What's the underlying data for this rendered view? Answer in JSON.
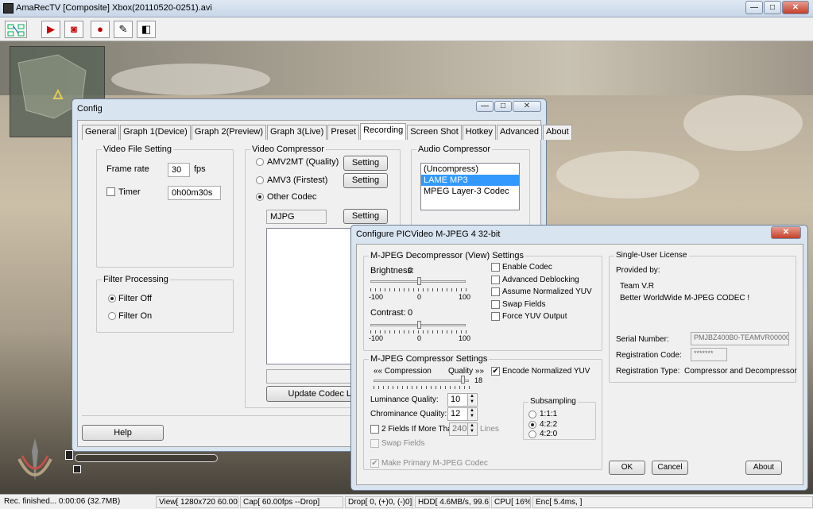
{
  "main": {
    "title": "AmaRecTV  [Composite]  Xbox(20110520-0251).avi",
    "min_glyph": "—",
    "max_glyph": "□",
    "close_glyph": "✕",
    "toolbar_glyphs": {
      "play": "▶",
      "camera": "◙",
      "record": "●",
      "pen": "✎",
      "audio": "◧"
    }
  },
  "config": {
    "title": "Config",
    "tabs": [
      "General",
      "Graph 1(Device)",
      "Graph 2(Preview)",
      "Graph 3(Live)",
      "Preset",
      "Recording",
      "Screen Shot",
      "Hotkey",
      "Advanced",
      "About"
    ],
    "video_file_setting": {
      "label": "Video File Setting",
      "frame_rate_label": "Frame rate",
      "frame_rate_value": "30",
      "fps_label": "fps",
      "timer_label": "Timer",
      "timer_checked": false,
      "timer_value": "0h00m30s"
    },
    "filter_processing": {
      "label": "Filter Processing",
      "options": [
        "Filter Off",
        "Filter On"
      ],
      "selected": "Filter Off"
    },
    "video_compressor": {
      "label": "Video Compressor",
      "options": [
        "AMV2MT (Quality)",
        "AMV3 (Firstest)",
        "Other Codec"
      ],
      "selected": "Other Codec",
      "setting_label": "Setting",
      "codec_value": "MJPG",
      "update_codec_label": "Update Codec L"
    },
    "audio_compressor": {
      "label": "Audio Compressor",
      "items": [
        "(Uncompress)",
        "LAME MP3",
        "MPEG Layer-3 Codec"
      ],
      "selected": "LAME MP3"
    },
    "help_label": "Help"
  },
  "pic": {
    "title": "Configure PICVideo M-JPEG 4 32-bit",
    "decompressor": {
      "label": "M-JPEG Decompressor (View) Settings",
      "brightness_label": "Brightness:",
      "brightness_value": "0",
      "contrast_label": "Contrast:",
      "contrast_value": "0",
      "min": "-100",
      "mid": "0",
      "max": "100",
      "checkboxes": [
        {
          "label": "Enable Codec",
          "checked": false
        },
        {
          "label": "Advanced Deblocking",
          "checked": false
        },
        {
          "label": "Assume Normalized YUV",
          "checked": false
        },
        {
          "label": "Swap Fields",
          "checked": false
        },
        {
          "label": "Force YUV Output",
          "checked": false
        }
      ]
    },
    "compressor": {
      "label": "M-JPEG Compressor Settings",
      "compression_label": "«« Compression",
      "quality_label": "Quality »»",
      "quality_value": "18",
      "encode_normalized_label": "Encode Normalized YUV",
      "encode_normalized_checked": true,
      "luminance_label": "Luminance Quality:",
      "luminance_value": "10",
      "chrominance_label": "Chrominance Quality:",
      "chrominance_value": "12",
      "two_fields_label": "2 Fields If More Than",
      "two_fields_value": "240",
      "lines_label": "Lines",
      "swap_fields_label": "Swap Fields",
      "subsampling_label": "Subsampling",
      "subsampling_options": [
        "1:1:1",
        "4:2:2",
        "4:2:0"
      ],
      "subsampling_selected": "4:2:2"
    },
    "make_primary_label": "Make Primary M-JPEG Codec",
    "license": {
      "label": "Single-User License",
      "provided_by_label": "Provided by:",
      "provider_name": "Team V.R",
      "provider_tagline": "Better WorldWide M-JPEG CODEC !",
      "serial_label": "Serial Number:",
      "serial_value": "PMJBZ400B0-TEAMVR00000",
      "reg_code_label": "Registration Code:",
      "reg_code_value": "*******",
      "reg_type_label": "Registration Type:",
      "reg_type_value": "Compressor and Decompressor"
    },
    "ok_label": "OK",
    "cancel_label": "Cancel",
    "about_label": "About"
  },
  "status": {
    "rec": "Rec. finished... 0:00:06 (32.7MB)",
    "view": "View[ 1280x720 60.00fps]",
    "cap": "Cap[ 60.00fps --Drop]",
    "drop": "Drop[  0, (+)0, (-)0]",
    "hdd": "HDD[ 4.6MB/s, 99.6%]",
    "cpu": "CPU[ 16%]",
    "enc": "Enc[ 5.4ms, ]"
  }
}
